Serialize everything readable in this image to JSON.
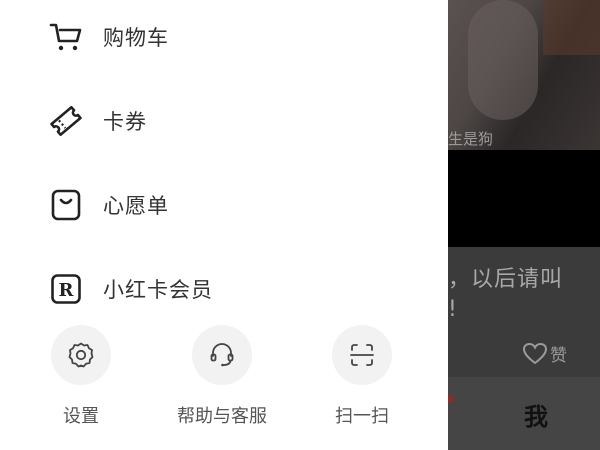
{
  "drawer": {
    "menu": [
      {
        "label": "购物车",
        "icon": "shopping-cart-icon"
      },
      {
        "label": "卡券",
        "icon": "coupon-icon"
      },
      {
        "label": "心愿单",
        "icon": "wishlist-bag-icon"
      },
      {
        "label": "小红卡会员",
        "icon": "membership-r-icon"
      }
    ],
    "actions": [
      {
        "label": "设置",
        "icon": "gear-icon"
      },
      {
        "label": "帮助与客服",
        "icon": "headset-icon"
      },
      {
        "label": "扫一扫",
        "icon": "scan-icon"
      }
    ]
  },
  "background": {
    "caption": "生是狗",
    "text_line1": "，以后请叫",
    "text_line2": "!",
    "like_label": "赞",
    "tab_me": "我"
  },
  "colors": {
    "drawer_bg": "#ffffff",
    "icon_stroke": "#222222",
    "label_text": "#333333",
    "action_circle_bg": "#f2f2f2",
    "overlay_dim": "#3a3a3a"
  }
}
